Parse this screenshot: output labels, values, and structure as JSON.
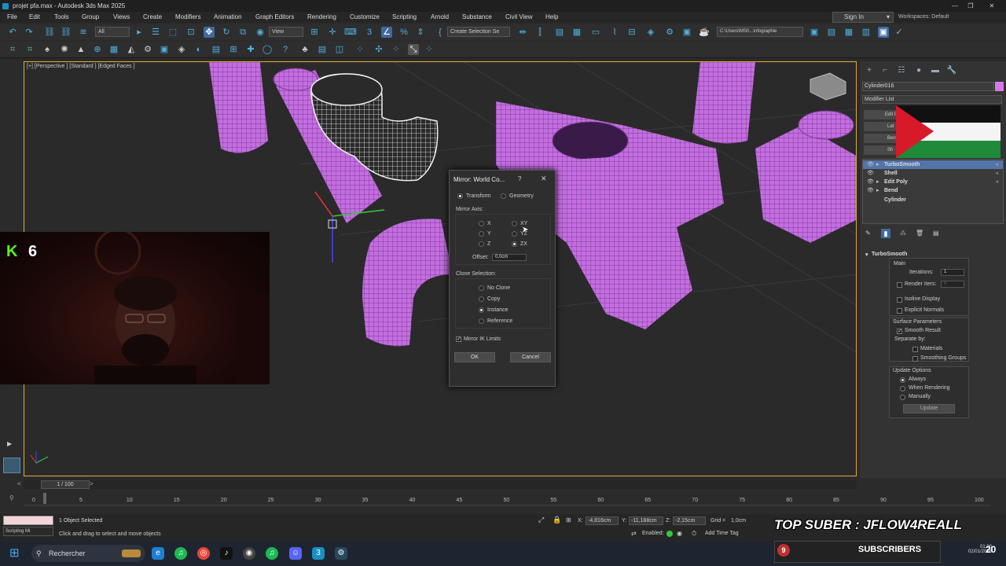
{
  "window": {
    "title": "projet pfa.max - Autodesk 3ds Max 2025"
  },
  "menu": [
    "File",
    "Edit",
    "Tools",
    "Group",
    "Views",
    "Create",
    "Modifiers",
    "Animation",
    "Graph Editors",
    "Rendering",
    "Customize",
    "Scripting",
    "Arnold",
    "Substance",
    "Civil View",
    "Help"
  ],
  "account": {
    "signin": "Sign In",
    "workspaces_label": "Workspaces:",
    "workspaces_value": "Default"
  },
  "toolbar": {
    "filter_value": "All",
    "view_value": "View",
    "selection_set": "Create Selection Se",
    "path": "C:\\Users\\MSI\\...\\nfographie"
  },
  "viewport": {
    "label": "[+] [Perspective ] [Standard ] [Edged Faces ]"
  },
  "command_panel": {
    "object_name": "Cylinder016",
    "object_color": "#d478ea",
    "modifier_list": "Modifier List",
    "side_buttons": [
      "Edit P",
      "Lat",
      "Ben",
      "Sh"
    ],
    "stack": [
      "TurboSmooth",
      "Shell",
      "Edit Poly",
      "Bend",
      "Cylinder"
    ]
  },
  "turbosmooth": {
    "title": "TurboSmooth",
    "main": "Main",
    "iterations_label": "Iterations:",
    "iterations_value": "1",
    "render_iters_label": "Render Iters:",
    "render_iters_value": "0",
    "isoline": "Isoline Display",
    "explicit": "Explicit Normals",
    "surface_params": "Surface Parameters",
    "smooth_result": "Smooth Result",
    "separate_by": "Separate by:",
    "materials": "Materials",
    "smoothing_groups": "Smoothing Groups",
    "update_options": "Update Options",
    "always": "Always",
    "when_rendering": "When Rendering",
    "manually": "Manually",
    "update_button": "Update"
  },
  "dialog": {
    "title": "Mirror: World Co...",
    "help": "?",
    "close": "✕",
    "transform": "Transform",
    "geometry": "Geometry",
    "mirror_axis": "Mirror Axis:",
    "axes_left": [
      "X",
      "Y",
      "Z"
    ],
    "axes_right": [
      "XY",
      "YZ",
      "ZX"
    ],
    "selected_axis": "ZX",
    "offset_label": "Offset:",
    "offset_value": "0,0cm",
    "clone_selection": "Clone Selection:",
    "clone_options": [
      "No Clone",
      "Copy",
      "Instance",
      "Reference"
    ],
    "selected_clone": "Instance",
    "mirror_ik": "Mirror IK Limits",
    "ok": "OK",
    "cancel": "Cancel"
  },
  "overlay": {
    "kick_count": "6",
    "top_suber": "TOP SUBER : JFLOW4REALL",
    "subscribers_label": "SUBSCRIBERS",
    "subscribers_count": "9",
    "big_number": "20"
  },
  "timeline": {
    "frame": "1 / 100",
    "ticks": [
      "0",
      "5",
      "10",
      "15",
      "20",
      "25",
      "30",
      "35",
      "40",
      "45",
      "50",
      "55",
      "60",
      "65",
      "70",
      "75",
      "80",
      "85",
      "90",
      "95",
      "100"
    ]
  },
  "status": {
    "selected": "1 Object Selected",
    "hint": "Click and drag to select and move objects",
    "maxscript": "Scripting Mi",
    "x_label": "X:",
    "x": "-4,816cm",
    "y_label": "Y:",
    "y": "-11,188cm",
    "z_label": "Z:",
    "z": "-2,15cm",
    "grid_label": "Grid =",
    "grid": "1,0cm",
    "enabled": "Enabled:",
    "add_time_tag": "Add Time Tag"
  },
  "taskbar": {
    "search": "Rechercher",
    "time": "01:20",
    "date": "02/01/2026"
  }
}
